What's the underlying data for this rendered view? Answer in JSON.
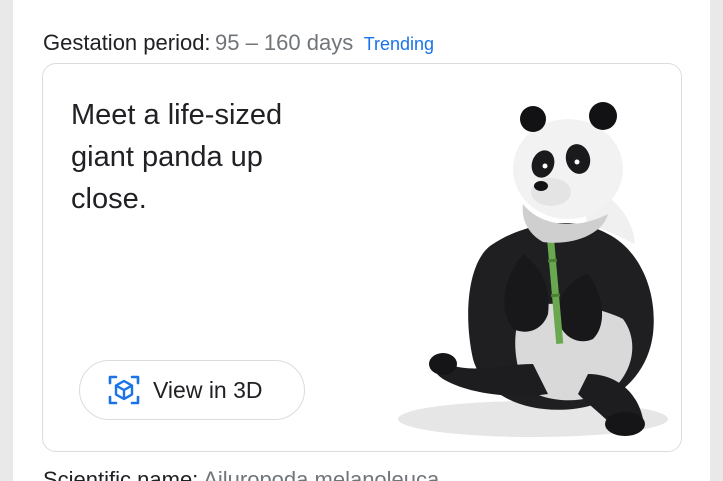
{
  "facts": {
    "gestation": {
      "label": "Gestation period:",
      "value": "95 – 160 days",
      "trending_label": "Trending"
    },
    "next_fact": {
      "label": "Scientific name:",
      "value": "Ailuropoda melanoleuca"
    }
  },
  "ar_card": {
    "headline": "Meet a life-sized giant panda up close.",
    "button_label": "View in 3D",
    "button_icon": "cube-ar-icon",
    "image_subject": "giant-panda-3d-model"
  },
  "colors": {
    "link_blue": "#1a73e8",
    "text_primary": "#202124",
    "text_secondary": "#70757a",
    "border": "#dadce0"
  }
}
